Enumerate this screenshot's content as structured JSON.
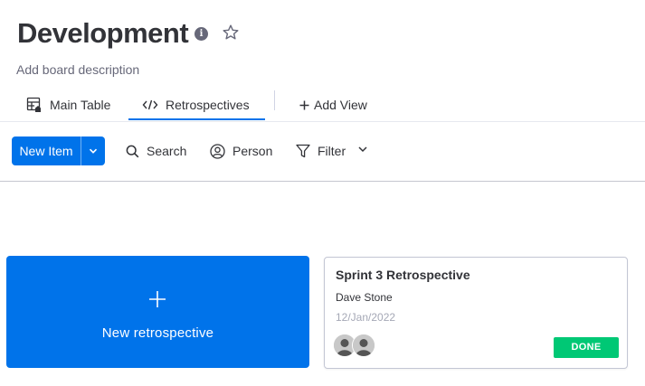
{
  "board": {
    "title": "Development",
    "description": "Add board description"
  },
  "tabs": {
    "main_table": "Main Table",
    "retrospectives": "Retrospectives",
    "add_view": "Add View"
  },
  "toolbar": {
    "new_item": "New Item",
    "search": "Search",
    "person": "Person",
    "filter": "Filter"
  },
  "new_retrospective": {
    "label": "New retrospective"
  },
  "card": {
    "title": "Sprint 3 Retrospective",
    "person": "Dave Stone",
    "date": "12/Jan/2022",
    "status": "DONE"
  },
  "colors": {
    "primary": "#0073ea",
    "done": "#00c875",
    "text": "#323338",
    "muted": "#676879"
  },
  "icons": [
    "info-icon",
    "star-icon",
    "table-icon",
    "code-icon",
    "plus-icon",
    "chevron-down-icon",
    "search-icon",
    "person-icon",
    "filter-icon",
    "avatar-icon"
  ]
}
